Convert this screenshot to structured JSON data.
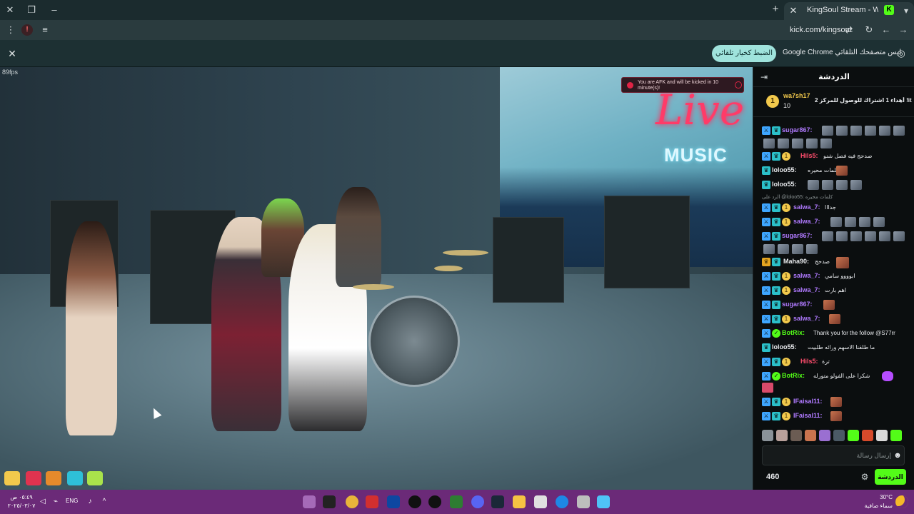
{
  "browser": {
    "tab_title": "KingSoul Stream - Watch Li",
    "url": "kick.com/kingsoul",
    "infobar_text": "Google Chrome ليس متصفحك التلقائي",
    "infobar_button": "الضبط كخيار تلقائي"
  },
  "video": {
    "fps": "89fps",
    "afk_notice": "You are AFK and will be kicked in 10 minute(s)!",
    "sign_live": "Live",
    "sign_music": "MUSIC"
  },
  "chat": {
    "title": "الدردشة",
    "pinned": {
      "user": "wa7sh17",
      "count": "10",
      "message": "أهداء 1 اشتراك للوصول للمركز 2 !ith"
    },
    "messages": [
      {
        "user": "sugar867",
        "color": "#b07aff",
        "text": ""
      },
      {
        "user": "Hils5",
        "color": "#ff4d6d",
        "text": "صدحج فيه فصل شنو"
      },
      {
        "user": "loloo55",
        "color": "#e8eaed",
        "text": "كلمات محيره"
      },
      {
        "user": "loloo55",
        "color": "#e8eaed",
        "text": ""
      },
      {
        "user": "",
        "color": "#8a9293",
        "text": "الرد على @loloo55: كلمات محيره"
      },
      {
        "user": "salwa_7",
        "color": "#b07aff",
        "text": "جدااا"
      },
      {
        "user": "salwa_7",
        "color": "#b07aff",
        "text": ""
      },
      {
        "user": "sugar867",
        "color": "#b07aff",
        "text": ""
      },
      {
        "user": "Maha90",
        "color": "#e8eaed",
        "text": "صدحج"
      },
      {
        "user": "salwa_7",
        "color": "#b07aff",
        "text": "ابوووو سامي"
      },
      {
        "user": "salwa_7",
        "color": "#b07aff",
        "text": "اهم بارت"
      },
      {
        "user": "sugar867",
        "color": "#b07aff",
        "text": ""
      },
      {
        "user": "salwa_7",
        "color": "#b07aff",
        "text": ""
      },
      {
        "user": "BotRix",
        "color": "#53fc18",
        "text": "Thank you for the follow @S77rr"
      },
      {
        "user": "loloo55",
        "color": "#e8eaed",
        "text": "ما طلقنا الاسهم ورائه طلبيت"
      },
      {
        "user": "Hils5",
        "color": "#ff4d6d",
        "text": "ترة"
      },
      {
        "user": "BotRix",
        "color": "#53fc18",
        "text": "شكرا على الفولو متورله"
      },
      {
        "user": "IFaisal11",
        "color": "#b07aff",
        "text": ""
      },
      {
        "user": "IFaisal11",
        "color": "#b07aff",
        "text": ""
      }
    ],
    "input_placeholder": "إرسال رسالة",
    "points": "460",
    "send_label": "الدردشة"
  },
  "taskbar": {
    "date_time": "٠٥:٤٩ ص",
    "date": "٢٠٢٥/٠٣/٠٧",
    "lang": "ENG",
    "temp": "30°C",
    "weather": "سماء صافية"
  },
  "colors": {
    "kick_green": "#53fc18",
    "taskbar": "#6b2a78",
    "chrome_bg": "#1b2b2e"
  }
}
